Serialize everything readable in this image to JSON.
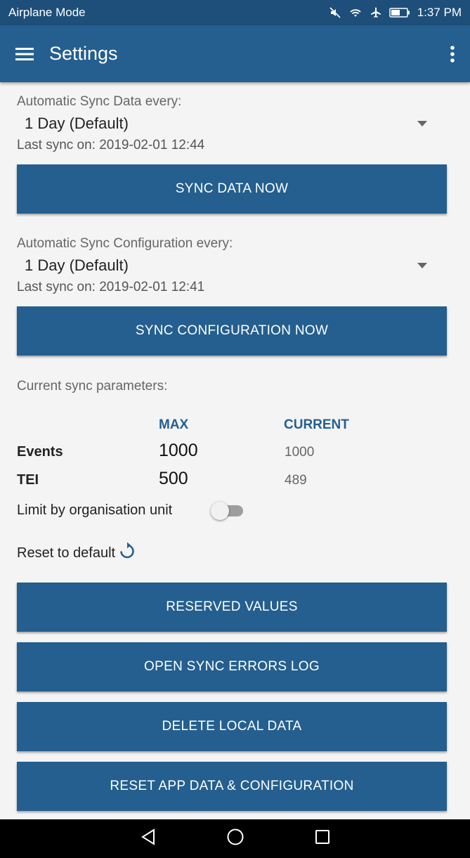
{
  "status_bar": {
    "left_text": "Airplane Mode",
    "time": "1:37 PM",
    "icons": [
      "mute-icon",
      "wifi-icon",
      "airplane-icon",
      "battery-icon"
    ]
  },
  "app_bar": {
    "title": "Settings",
    "menu_icon": "hamburger-menu-icon",
    "more_icon": "more-vertical-icon"
  },
  "data_sync": {
    "label": "Automatic Sync Data every:",
    "selected": "1 Day (Default)",
    "last_sync": "Last sync on: 2019-02-01 12:44",
    "button": "SYNC DATA NOW"
  },
  "config_sync": {
    "label": "Automatic Sync Configuration every:",
    "selected": "1 Day (Default)",
    "last_sync": "Last sync on: 2019-02-01 12:41",
    "button": "SYNC CONFIGURATION NOW"
  },
  "params": {
    "title": "Current sync parameters:",
    "col_max": "MAX",
    "col_current": "CURRENT",
    "rows": [
      {
        "label": "Events",
        "max": "1000",
        "current": "1000"
      },
      {
        "label": "TEI",
        "max": "500",
        "current": "489"
      }
    ],
    "limit_label": "Limit by organisation unit",
    "limit_on": false,
    "reset_label": "Reset to default"
  },
  "buttons": {
    "reserved": "RESERVED VALUES",
    "errors": "OPEN SYNC ERRORS LOG",
    "delete": "DELETE LOCAL DATA",
    "reset_app": "RESET APP DATA & CONFIGURATION"
  },
  "colors": {
    "primary": "#245f8f",
    "status_bar": "#1d4f7a",
    "background": "#f4f4f4"
  }
}
